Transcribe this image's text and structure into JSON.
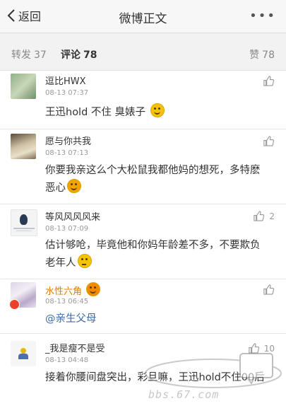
{
  "nav": {
    "back_label": "返回",
    "title": "微博正文",
    "more_label": "•••"
  },
  "tabs": {
    "repost_label": "转发",
    "repost_count": "37",
    "comment_label": "评论",
    "comment_count": "78",
    "like_label": "赞",
    "like_count": "78"
  },
  "comments": [
    {
      "name": "逗比HWX",
      "time": "08-13 07:37",
      "text": "王迅hold 不住 臭婊子"
    },
    {
      "name": "愿与你共我",
      "time": "08-13 07:13",
      "text": "你要我亲这么个大松鼠我都他妈的想死，多特麽恶心"
    },
    {
      "name": "等风风风风来",
      "time": "08-13 07:09",
      "text": "估计够呛，毕竟他和你妈年龄差不多，不要欺负老年人",
      "likes": "2"
    },
    {
      "name": "水性六角",
      "time": "08-13 06:45",
      "text": "@亲生父母"
    },
    {
      "name": "_我是瘦不是受",
      "time": "08-13 04:48",
      "text": "接着你腰间盘突出，彩旦嘛，王迅hold不住00后",
      "likes": "10"
    }
  ],
  "watermark": {
    "site_text": "bbs.67.com"
  },
  "colors": {
    "accent_orange": "#e07b00",
    "mention_blue": "#3c6aa6",
    "nav_bg": "#f7f7f7"
  }
}
